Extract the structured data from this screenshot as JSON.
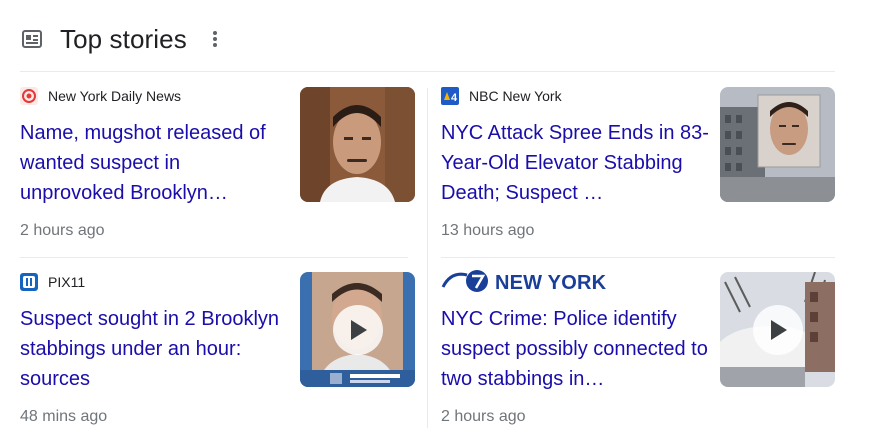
{
  "header": {
    "title": "Top stories"
  },
  "stories": [
    {
      "source": "New York Daily News",
      "headline": "Name, mugshot released of wanted suspect in unprovoked Brooklyn…",
      "time": "2 hours ago",
      "has_video": false
    },
    {
      "source": "NBC New York",
      "headline": "NYC Attack Spree Ends in 83-Year-Old Elevator Stabbing Death; Suspect …",
      "time": "13 hours ago",
      "has_video": false
    },
    {
      "source": "PIX11",
      "headline": "Suspect sought in 2 Brooklyn stabbings under an hour: sources",
      "time": "48 mins ago",
      "has_video": true
    },
    {
      "source": "NEW YORK",
      "headline": "NYC Crime: Police identify suspect possibly connected to two stabbings in…",
      "time": "2 hours ago",
      "has_video": true
    }
  ],
  "colors": {
    "link": "#1a0dab",
    "meta": "#70757a",
    "divider": "#e8eaed",
    "abc_blue": "#1a3f99"
  },
  "icons": [
    "news-icon",
    "more-vert-icon",
    "daily-news-logo-icon",
    "nbc-4-logo-icon",
    "pix11-logo-icon",
    "abc7-logo-icon",
    "play-icon"
  ]
}
